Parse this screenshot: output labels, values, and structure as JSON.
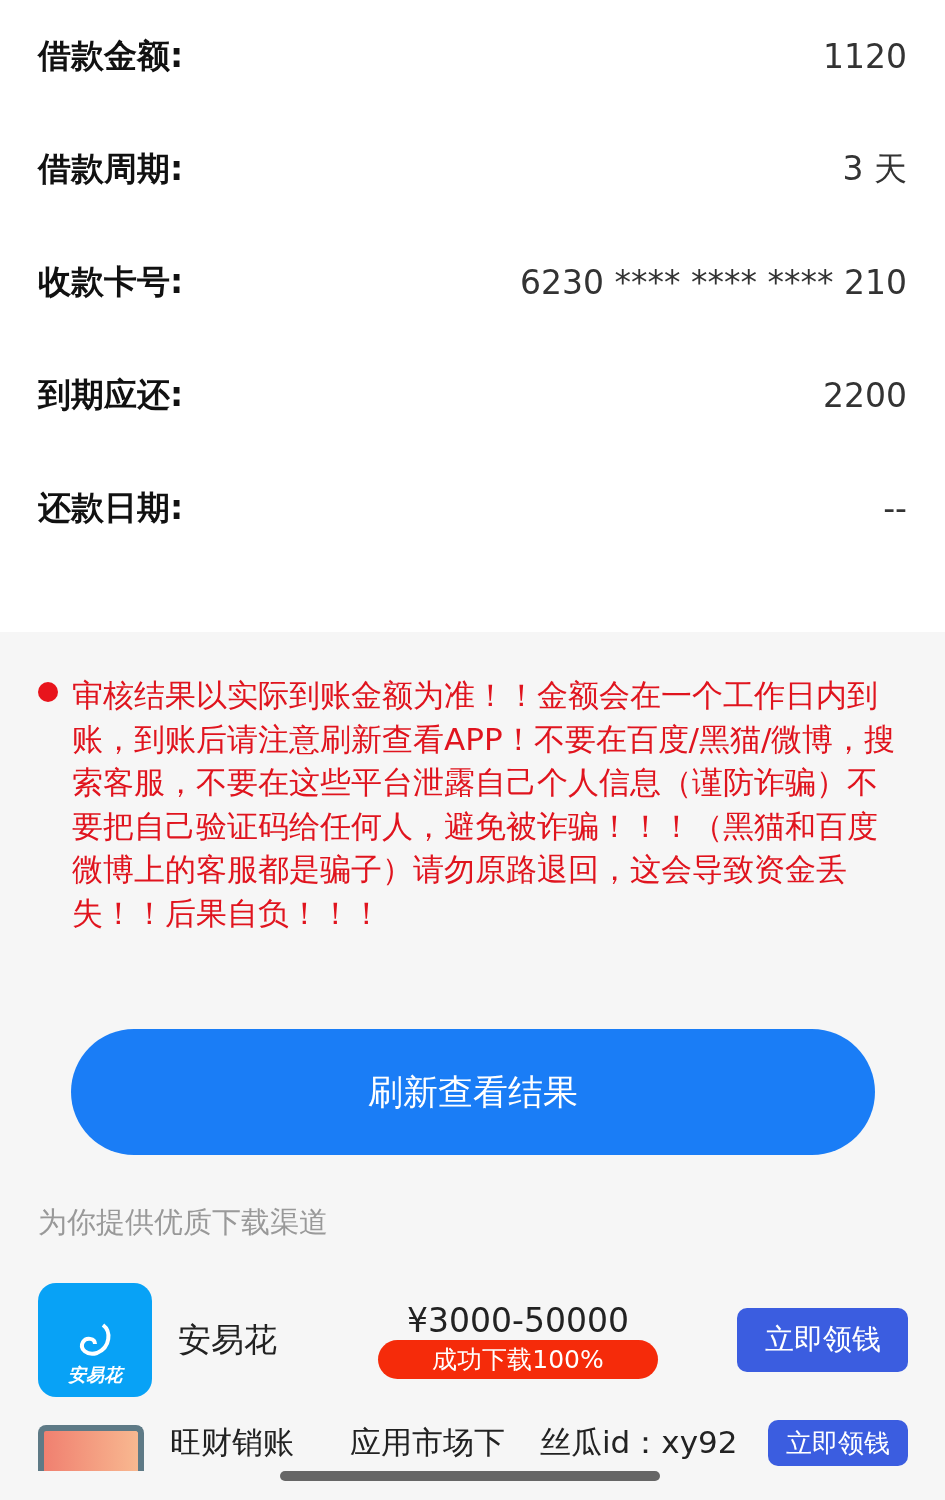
{
  "details": [
    {
      "label": "借款金额:",
      "value": "1120"
    },
    {
      "label": "借款周期:",
      "value": "3 天"
    },
    {
      "label": "收款卡号:",
      "value": "6230 **** **** **** 210"
    },
    {
      "label": "到期应还:",
      "value": "2200"
    },
    {
      "label": "还款日期:",
      "value": "--"
    }
  ],
  "notice": "审核结果以实际到账金额为准！！金额会在一个工作日内到账，到账后请注意刷新查看APP！不要在百度/黑猫/微博，搜索客服，不要在这些平台泄露自己个人信息（谨防诈骗）不要把自己验证码给任何人，避免被诈骗！！！（黑猫和百度微博上的客服都是骗子）请勿原路退回，这会导致资金丢失！！后果自负！！！",
  "refresh_button": "刷新查看结果",
  "section_title": "为你提供优质下载渠道",
  "apps": [
    {
      "kind": "logo",
      "icon_label": "安易花",
      "name": "安易花",
      "amount": "¥3000-50000",
      "badge": "成功下载100%",
      "button": "立即领钱"
    },
    {
      "kind": "plain",
      "name": "旺财销账",
      "amount": "应用市场下",
      "button": "立即领钱"
    }
  ],
  "overlay_text": "丝瓜id：xy92"
}
